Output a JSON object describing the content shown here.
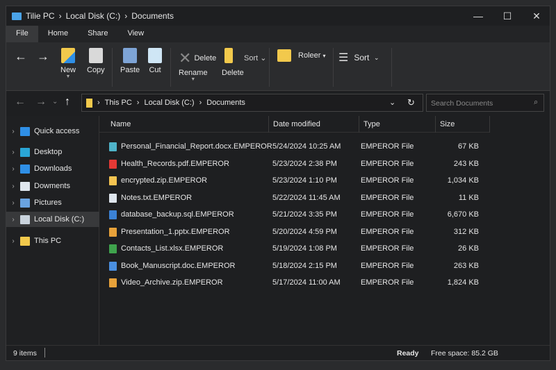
{
  "title": {
    "crumbs": [
      "Tilie PC",
      "Local Disk (C:)",
      "Documents"
    ]
  },
  "window_controls": {
    "minimize": "—",
    "maximize": "☐",
    "close": "✕"
  },
  "menu": [
    "File",
    "Home",
    "Share",
    "View"
  ],
  "ribbon": {
    "new": "New",
    "copy": "Copy",
    "paste": "Paste",
    "cut": "Cut",
    "delete_small": "Delete",
    "rename": "Rename",
    "sort_small": "Sort",
    "delete": "Delete",
    "folder": "Roleer",
    "sort": "Sort"
  },
  "address": {
    "crumbs": [
      "This PC",
      "Local Disk (C:)",
      "Documents"
    ],
    "search_placeholder": "Search Documents"
  },
  "sidebar": [
    {
      "label": "Quick access",
      "icon": "quick-access-icon",
      "color": "#2f8fe6"
    },
    {
      "label": "Desktop",
      "icon": "desktop-icon",
      "color": "#2aa6d6"
    },
    {
      "label": "Downloads",
      "icon": "download-icon",
      "color": "#2f8fe6"
    },
    {
      "label": "Dowments",
      "icon": "document-icon",
      "color": "#dfe6ee"
    },
    {
      "label": "Pictures",
      "icon": "pictures-icon",
      "color": "#6aa3e0"
    },
    {
      "label": "Local Disk (C:)",
      "icon": "drive-icon",
      "color": "#c9d3dd",
      "selected": true
    },
    {
      "label": "This PC",
      "icon": "folder-icon",
      "color": "#f2c94c"
    }
  ],
  "columns": [
    "Name",
    "Date modified",
    "Type",
    "Size"
  ],
  "files": [
    {
      "name": "Personal_Financial_Report.docx.EMPEROR",
      "date": "5/24/2024 10:25 AM",
      "type": "EMPEROR File",
      "size": "67 KB",
      "color": "#4fb3c9"
    },
    {
      "name": "Health_Records.pdf.EMPEROR",
      "date": "5/23/2024 2:38 PM",
      "type": "EMPEROR File",
      "size": "243 KB",
      "color": "#e53935"
    },
    {
      "name": "encrypted.zip.EMPEROR",
      "date": "5/23/2024 1:10 PM",
      "type": "EMPEROR File",
      "size": "1,034 KB",
      "color": "#f5c451"
    },
    {
      "name": "Notes.txt.EMPEROR",
      "date": "5/22/2024 11:45 AM",
      "type": "EMPEROR File",
      "size": "11 KB",
      "color": "#dfe6ee"
    },
    {
      "name": "database_backup.sql.EMPEROR",
      "date": "5/21/2024 3:35 PM",
      "type": "EMPEROR File",
      "size": "6,670 KB",
      "color": "#3b82d6"
    },
    {
      "name": "Presentation_1.pptx.EMPEROR",
      "date": "5/20/2024 4:59 PM",
      "type": "EMPEROR File",
      "size": "312 KB",
      "color": "#e8a23a"
    },
    {
      "name": "Contacts_List.xlsx.EMPEROR",
      "date": "5/19/2024 1:08 PM",
      "type": "EMPEROR File",
      "size": "26 KB",
      "color": "#3fa34d"
    },
    {
      "name": "Book_Manuscript.doc.EMPEROR",
      "date": "5/18/2024 2:15 PM",
      "type": "EMPEROR File",
      "size": "263 KB",
      "color": "#4a8fe0"
    },
    {
      "name": "Video_Archive.zip.EMPEROR",
      "date": "5/17/2024 11:00 AM",
      "type": "EMPEROR File",
      "size": "1,824 KB",
      "color": "#e8a23a"
    }
  ],
  "status": {
    "count": "9 items",
    "state": "Ready",
    "free": "Free space: 85.2 GB"
  }
}
